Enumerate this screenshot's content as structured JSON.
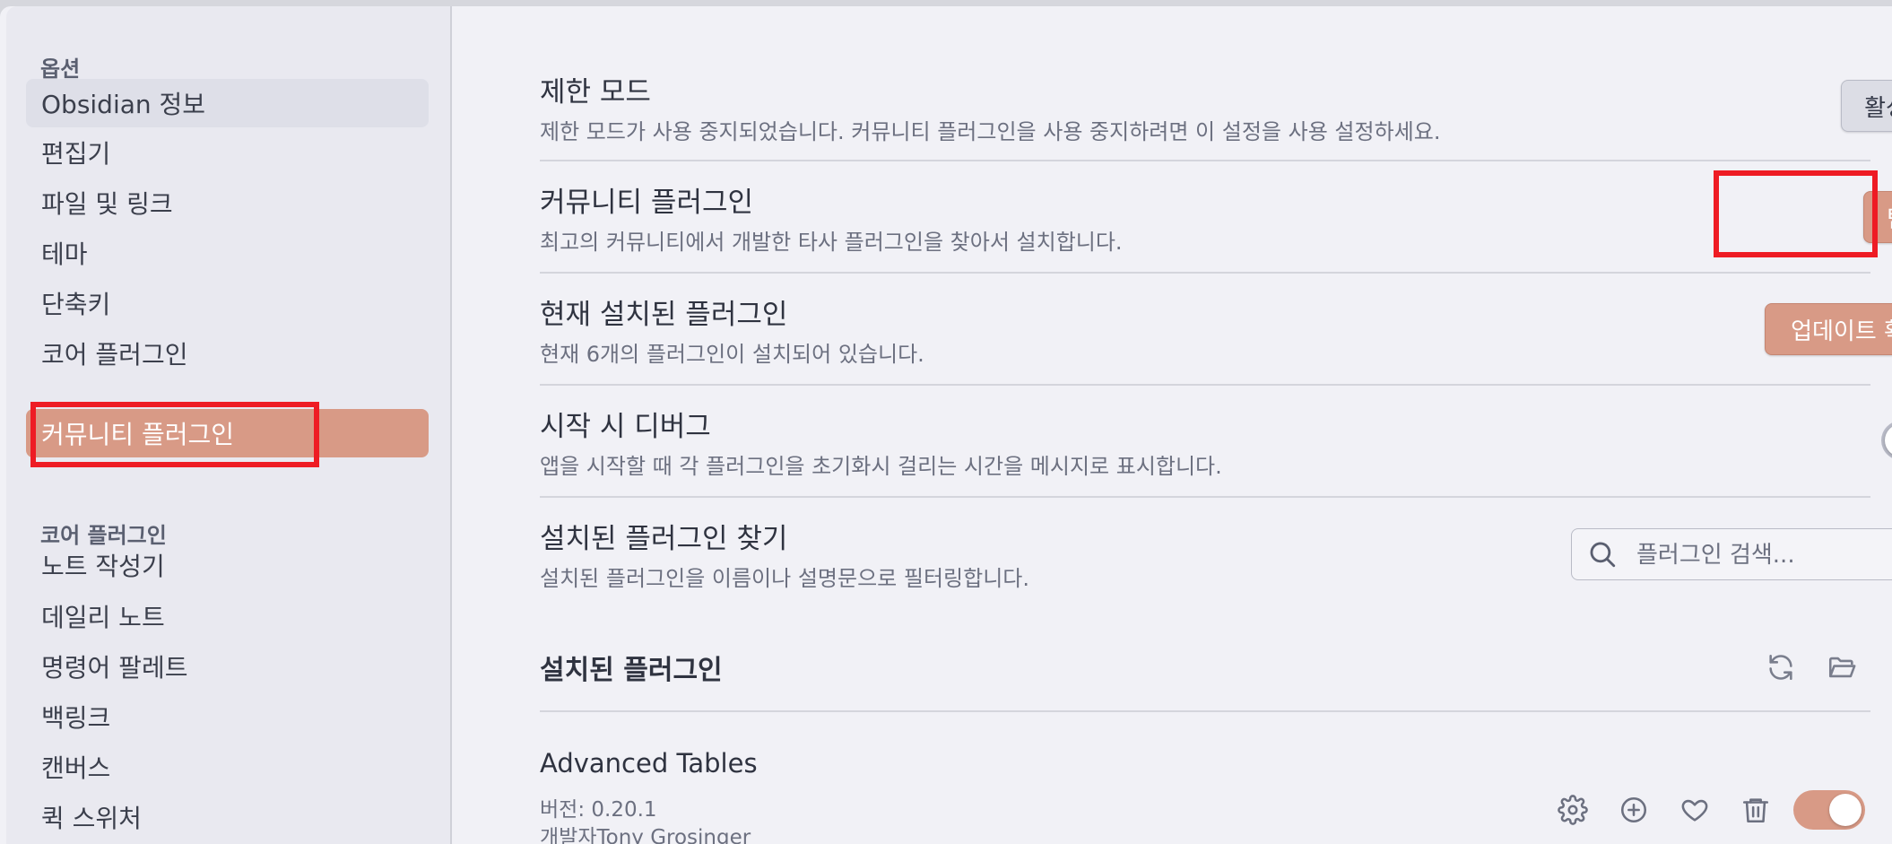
{
  "sidebar": {
    "options_title": "옵션",
    "options_items": [
      {
        "label": "Obsidian 정보"
      },
      {
        "label": "편집기"
      },
      {
        "label": "파일 및 링크"
      },
      {
        "label": "테마"
      },
      {
        "label": "단축키"
      },
      {
        "label": "코어 플러그인"
      },
      {
        "label": "커뮤니티 플러그인"
      }
    ],
    "core_title": "코어 플러그인",
    "core_items": [
      {
        "label": "노트 작성기"
      },
      {
        "label": "데일리 노트"
      },
      {
        "label": "명령어 팔레트"
      },
      {
        "label": "백링크"
      },
      {
        "label": "캔버스"
      },
      {
        "label": "퀵 스위처"
      }
    ]
  },
  "settings": {
    "restricted_mode": {
      "title": "제한 모드",
      "desc": "제한 모드가 사용 중지되었습니다. 커뮤니티 플러그인을 사용 중지하려면 이 설정을 사용 설정하세요.",
      "button": "활성화"
    },
    "community_plugins": {
      "title": "커뮤니티 플러그인",
      "desc": "최고의 커뮤니티에서 개발한 타사 플러그인을 찾아서 설치합니다.",
      "button": "탐색"
    },
    "installed_plugins": {
      "title": "현재 설치된 플러그인",
      "desc": "현재 6개의 플러그인이 설치되어 있습니다.",
      "button": "업데이트 확인"
    },
    "debug_startup": {
      "title": "시작 시 디버그",
      "desc": "앱을 시작할 때 각 플러그인을 초기화시 걸리는 시간을 메시지로 표시합니다.",
      "toggle_on": false
    },
    "find_installed": {
      "title": "설치된 플러그인 찾기",
      "desc": "설치된 플러그인을 이름이나 설명문으로 필터링합니다.",
      "search_placeholder": "플러그인 검색..."
    }
  },
  "installed_section": {
    "heading": "설치된 플러그인",
    "icons": [
      "refresh-icon",
      "folder-open-icon"
    ]
  },
  "plugins": [
    {
      "name": "Advanced Tables",
      "version": "버전: 0.20.1",
      "author": "개발자Tony Grosinger",
      "enabled": true,
      "icons": [
        "gear-icon",
        "plus-circle-icon",
        "heart-icon",
        "trash-icon"
      ]
    }
  ],
  "colors": {
    "accent": "#d89a86",
    "highlight": "#ee1c24",
    "background": "#f1f1f6",
    "sidebar": "#e9e9f0"
  }
}
